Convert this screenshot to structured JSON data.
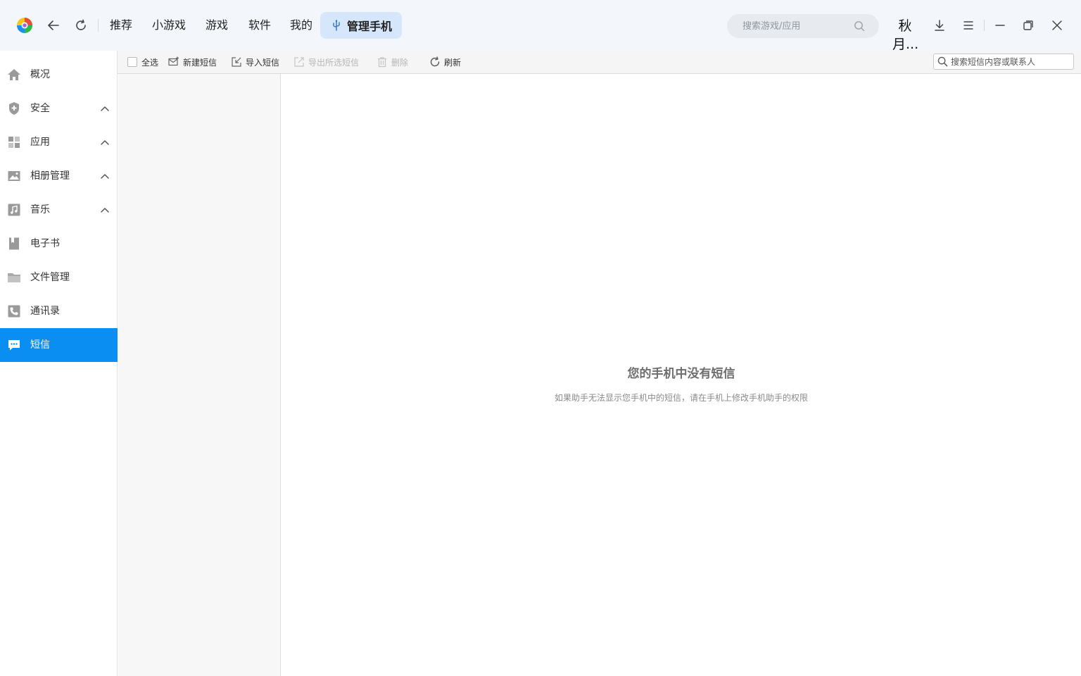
{
  "header": {
    "tabs": [
      "推荐",
      "小游戏",
      "游戏",
      "软件",
      "我的"
    ],
    "active_tab": "管理手机",
    "search_placeholder": "搜索游戏/应用",
    "user_name": "秋月..."
  },
  "sidebar": {
    "items": [
      {
        "label": "概况",
        "icon": "home-icon"
      },
      {
        "label": "安全",
        "icon": "shield-icon",
        "expandable": true
      },
      {
        "label": "应用",
        "icon": "apps-icon",
        "expandable": true
      },
      {
        "label": "相册管理",
        "icon": "photo-icon",
        "expandable": true
      },
      {
        "label": "音乐",
        "icon": "music-icon",
        "expandable": true
      },
      {
        "label": "电子书",
        "icon": "ebook-icon"
      },
      {
        "label": "文件管理",
        "icon": "folder-icon"
      },
      {
        "label": "通讯录",
        "icon": "phone-icon"
      },
      {
        "label": "短信",
        "icon": "message-icon",
        "active": true
      }
    ]
  },
  "toolbar": {
    "select_all": "全选",
    "new_sms": "新建短信",
    "import_sms": "导入短信",
    "export_selected": "导出所选短信",
    "delete": "删除",
    "refresh": "刷新",
    "search_placeholder": "搜索短信内容或联系人"
  },
  "empty_state": {
    "title": "您的手机中没有短信",
    "subtitle": "如果助手无法显示您手机中的短信，请在手机上修改手机助手的权限"
  },
  "colors": {
    "accent": "#0a8ef2",
    "topbar_bg": "#f3f7fc",
    "active_tab_bg": "#d6e7fb"
  }
}
